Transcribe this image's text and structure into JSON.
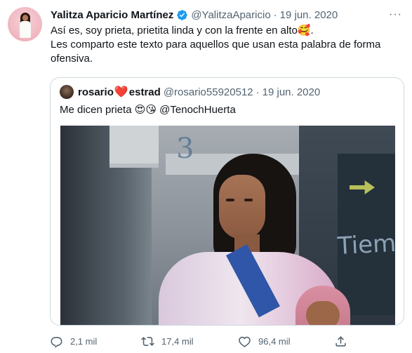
{
  "tweet": {
    "author_name": "Yalitza Aparicio Martínez",
    "handle": "@YalitzaAparicio",
    "separator": "·",
    "date": "19 jun. 2020",
    "text_line1": "Así es, soy prieta, prietita linda y con la frente en alto🥰.",
    "text_line2": "Les comparto este texto para aquellos que usan esta palabra de forma ofensiva.",
    "more_label": "···"
  },
  "quote": {
    "name_part1": "rosario",
    "name_heart": "❤️",
    "name_part2": "estrad",
    "handle": "@rosario55920512",
    "separator": "·",
    "date": "19 jun. 2020",
    "text": "Me dicen prieta 😍😘 @TenochHuerta"
  },
  "actions": {
    "reply_count": "2,1 mil",
    "retweet_count": "17,4 mil",
    "like_count": "96,4 mil"
  },
  "photo": {
    "graffiti": "Tiem",
    "mark": "3"
  },
  "colors": {
    "verified": "#1d9bf0",
    "secondary_text": "#536471",
    "border": "#cfd9de",
    "heart": "#e0245e"
  },
  "icons": [
    "verified-badge-icon",
    "more-icon",
    "reply-icon",
    "retweet-icon",
    "like-icon",
    "share-icon"
  ]
}
